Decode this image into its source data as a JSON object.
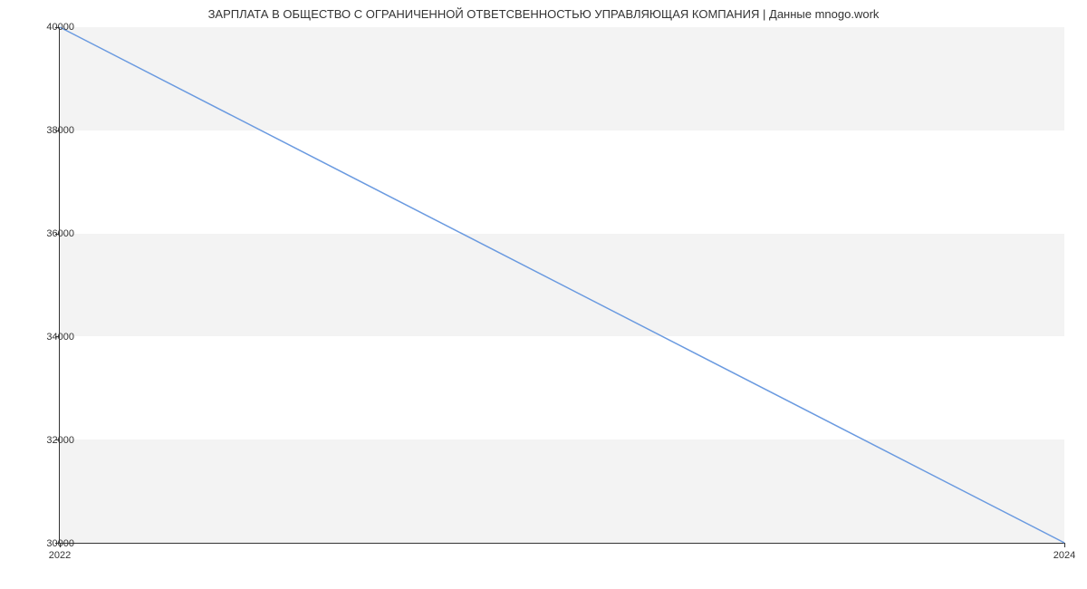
{
  "chart_data": {
    "type": "line",
    "title": "ЗАРПЛАТА В ОБЩЕСТВО С ОГРАНИЧЕННОЙ ОТВЕТСВЕННОСТЬЮ УПРАВЛЯЮЩАЯ КОМПАНИЯ | Данные mnogo.work",
    "x": [
      2022,
      2024
    ],
    "values": [
      40000,
      30000
    ],
    "xlabel": "",
    "ylabel": "",
    "x_ticks": [
      2022,
      2024
    ],
    "y_ticks": [
      30000,
      32000,
      34000,
      36000,
      38000,
      40000
    ],
    "xlim": [
      2022,
      2024
    ],
    "ylim": [
      30000,
      40000
    ]
  }
}
